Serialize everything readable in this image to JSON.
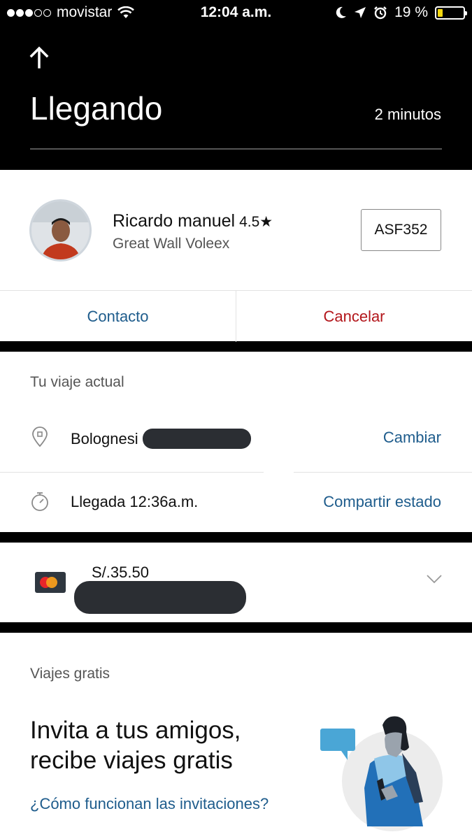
{
  "status_bar": {
    "carrier": "movistar",
    "time": "12:04 a.m.",
    "battery": "19 %",
    "battery_level": 0.19,
    "signal_bars": 3
  },
  "header": {
    "title": "Llegando",
    "eta": "2 minutos"
  },
  "driver": {
    "name": "Ricardo manuel",
    "rating": "4.5★",
    "car": "Great Wall Voleex",
    "plate": "ASF352"
  },
  "actions": {
    "contact": "Contacto",
    "cancel": "Cancelar"
  },
  "trip": {
    "section_label": "Tu viaje actual",
    "destination": "Bolognesi",
    "change_label": "Cambiar",
    "arrival": "Llegada 12:36a.m.",
    "share_label": "Compartir estado"
  },
  "payment": {
    "amount": "S/.35.50"
  },
  "free_trips": {
    "section_label": "Viajes gratis",
    "headline": "Invita a tus amigos, recibe viajes gratis",
    "link": "¿Cómo funcionan las invitaciones?"
  },
  "colors": {
    "link_blue": "#1e5c8c",
    "cancel_red": "#b3161b",
    "battery_yellow": "#f5d80f",
    "header_bg": "#000000"
  }
}
